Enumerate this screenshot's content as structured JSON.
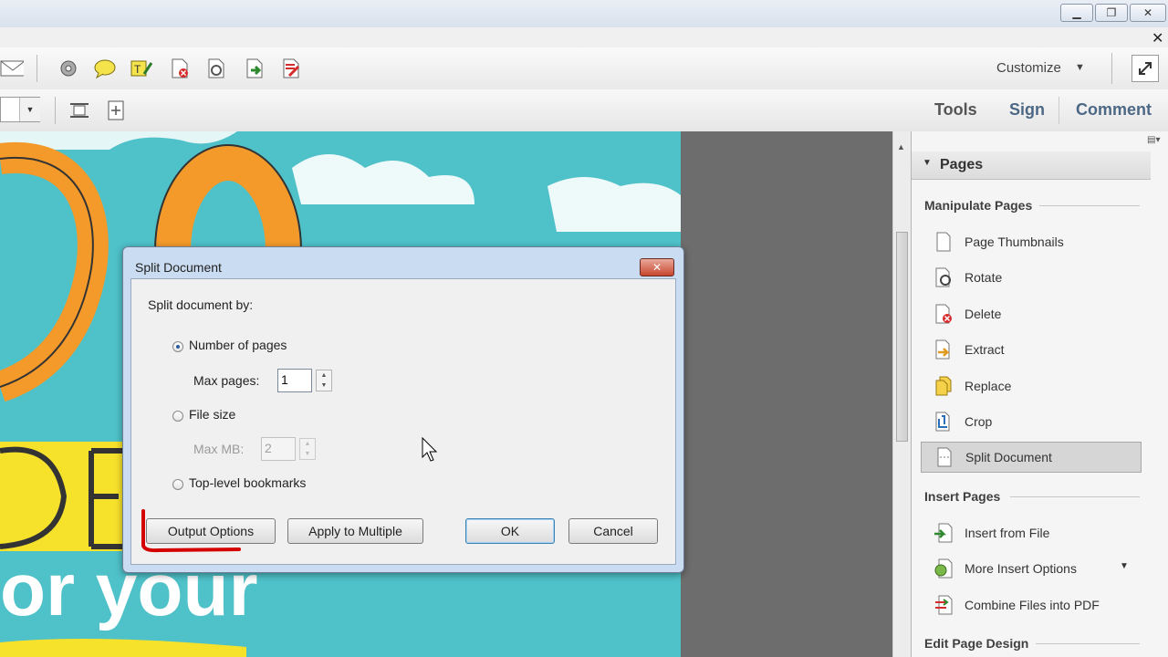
{
  "window": {
    "controls": [
      "minimize",
      "restore",
      "close"
    ]
  },
  "toolbar": {
    "customize_label": "Customize",
    "panes": {
      "tools": "Tools",
      "sign": "Sign",
      "comment": "Comment"
    }
  },
  "dialog": {
    "title": "Split Document",
    "prompt": "Split document by:",
    "options": {
      "number_of_pages": "Number of pages",
      "max_pages_label": "Max pages:",
      "max_pages_value": "1",
      "file_size": "File size",
      "max_mb_label": "Max MB:",
      "max_mb_value": "2",
      "top_level_bookmarks": "Top-level bookmarks"
    },
    "selected_option": "number_of_pages",
    "buttons": {
      "output_options": "Output Options",
      "apply_to_multiple": "Apply to Multiple",
      "ok": "OK",
      "cancel": "Cancel"
    }
  },
  "pane": {
    "header": "Pages",
    "sections": {
      "manipulate": "Manipulate Pages",
      "insert": "Insert Pages",
      "edit_design": "Edit Page Design"
    },
    "manipulate_items": [
      "Page Thumbnails",
      "Rotate",
      "Delete",
      "Extract",
      "Replace",
      "Crop",
      "Split Document"
    ],
    "insert_items": [
      "Insert from File",
      "More Insert Options",
      "Combine Files into PDF"
    ],
    "selected_item": "Split Document"
  },
  "colors": {
    "pane_link": "#4d6885",
    "annotation_red": "#d40000",
    "doc_teal": "#4fc1c9",
    "doc_orange": "#f39a2a"
  }
}
